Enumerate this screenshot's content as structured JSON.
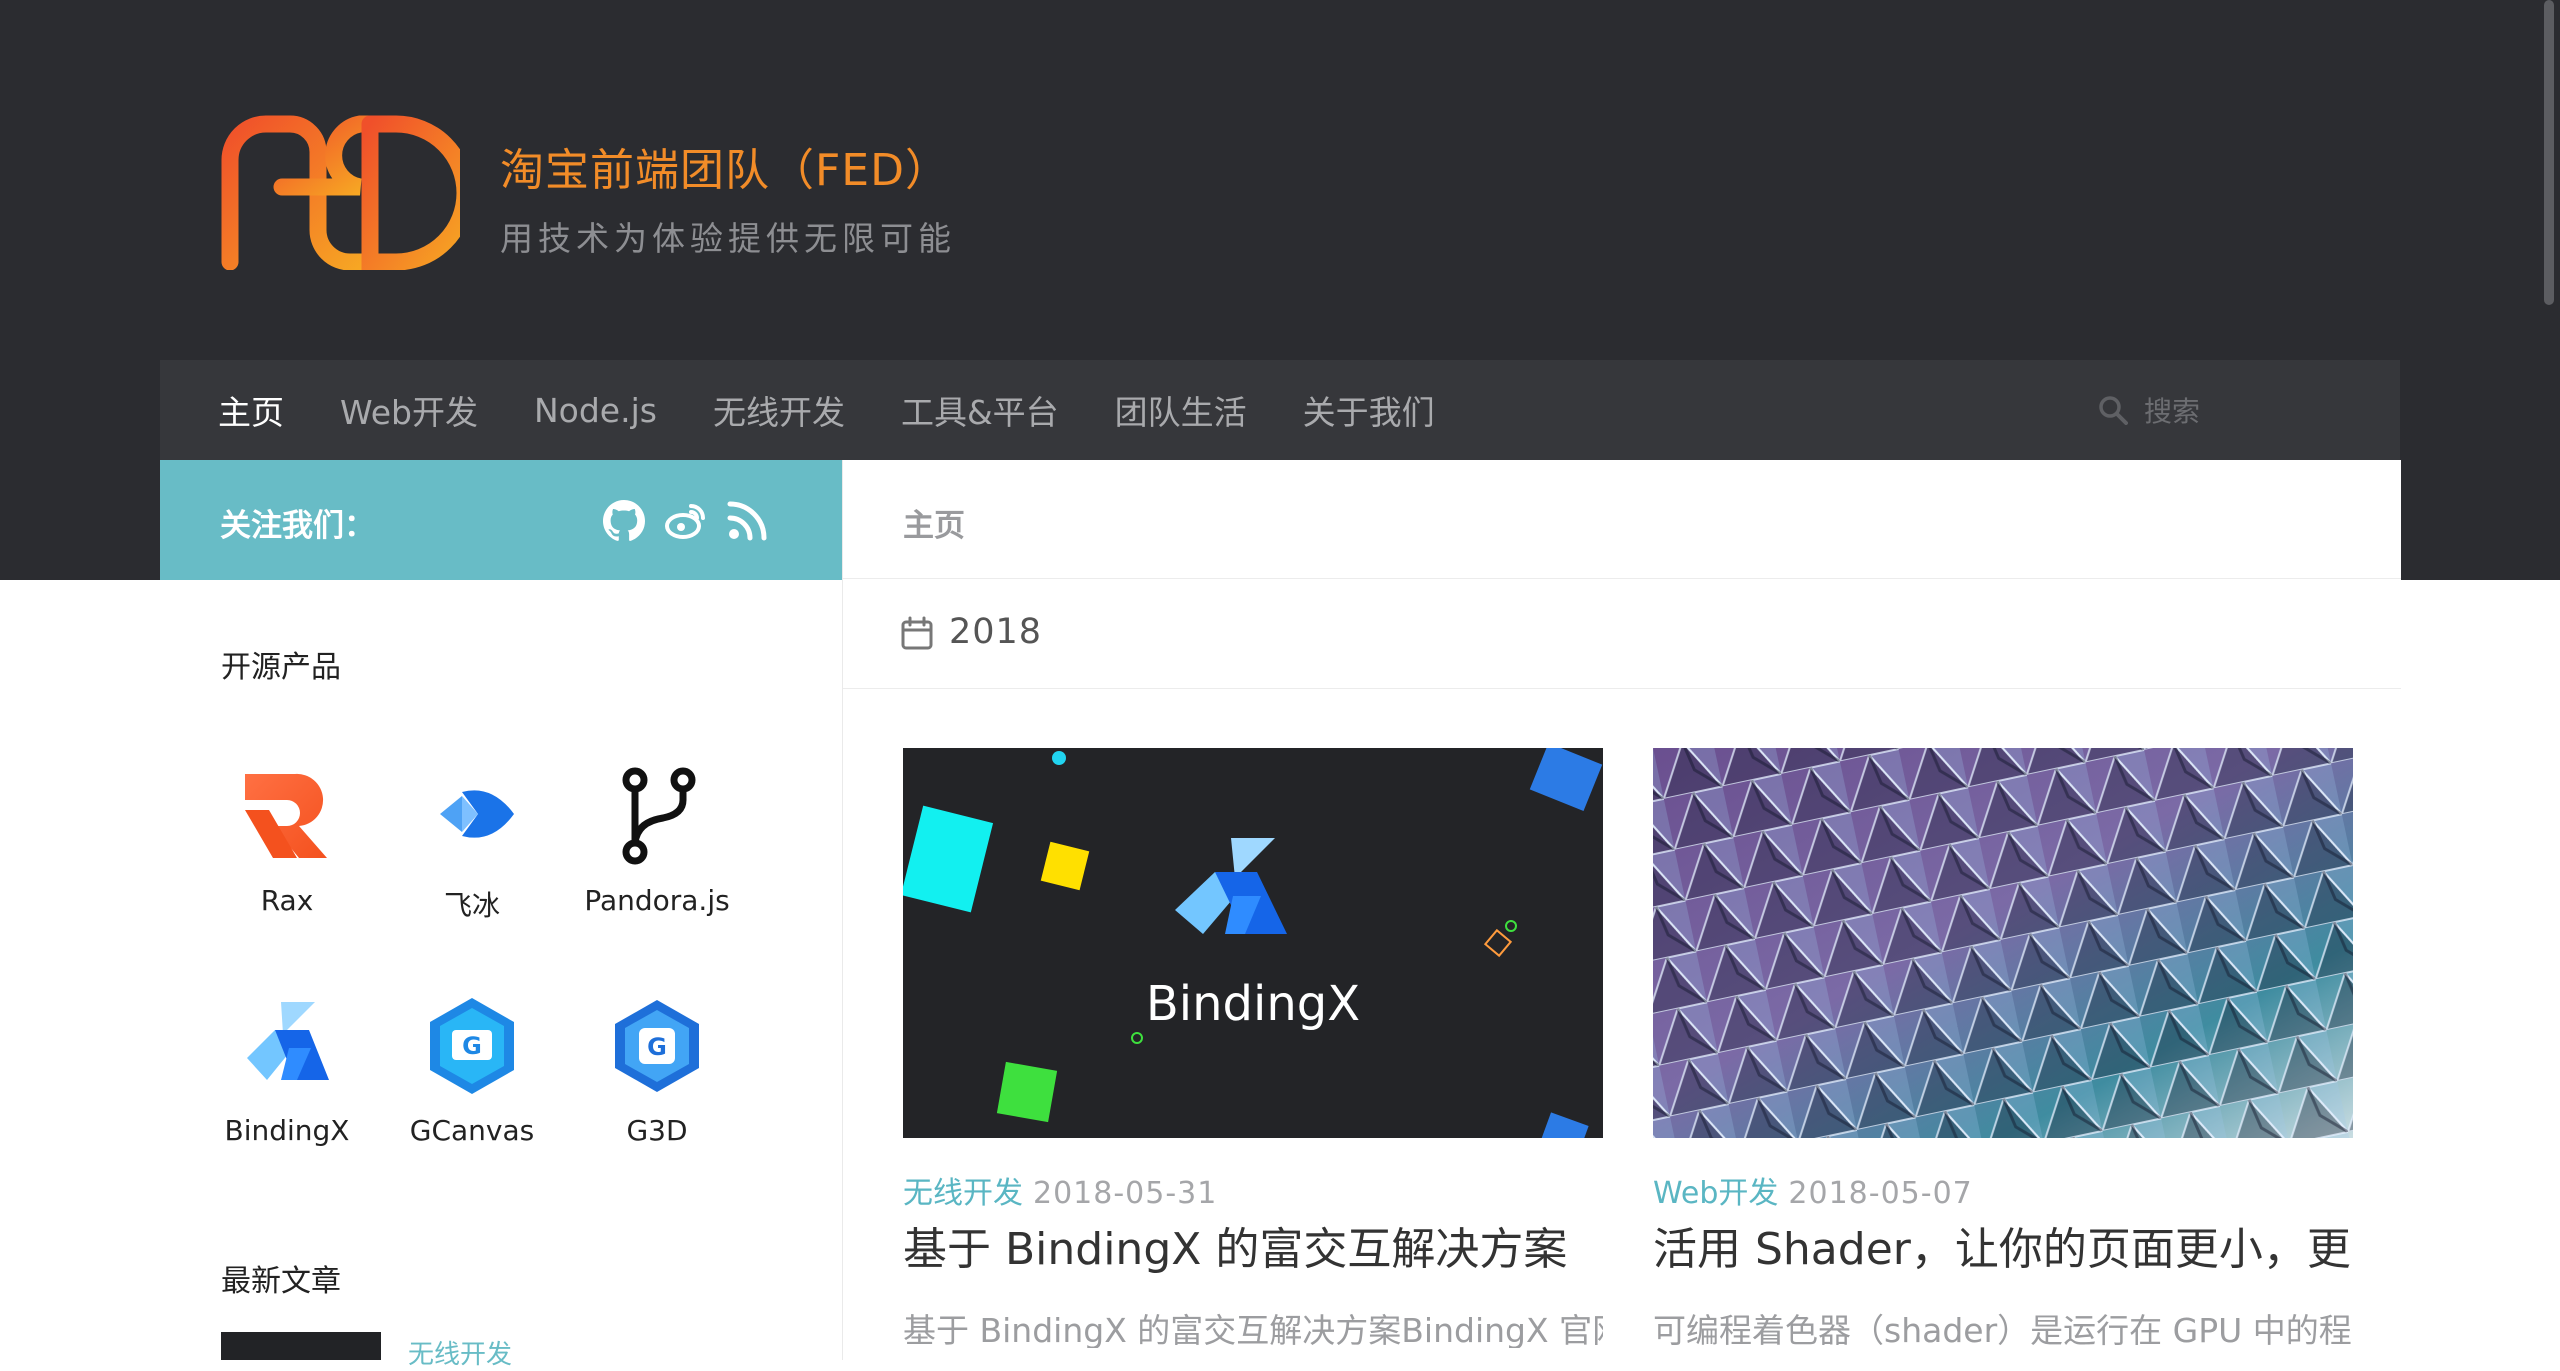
{
  "site": {
    "title": "淘宝前端团队（FED）",
    "tagline": "用技术为体验提供无限可能",
    "accent": "#f28c28",
    "teal": "#68bcc6"
  },
  "nav": {
    "items": [
      {
        "label": "主页",
        "active": true
      },
      {
        "label": "Web开发"
      },
      {
        "label": "Node.js"
      },
      {
        "label": "无线开发"
      },
      {
        "label": "工具&平台"
      },
      {
        "label": "团队生活"
      },
      {
        "label": "关于我们"
      }
    ],
    "search_placeholder": "搜索",
    "search_icon": "search-icon"
  },
  "follow": {
    "label": "关注我们：",
    "icons": [
      "github-icon",
      "weibo-icon",
      "rss-icon"
    ]
  },
  "sidebar": {
    "products_heading": "开源产品",
    "products": [
      {
        "label": "Rax",
        "icon": "rax-logo-icon"
      },
      {
        "label": "飞冰",
        "icon": "ice-logo-icon"
      },
      {
        "label": "Pandora.js",
        "icon": "pandora-logo-icon"
      },
      {
        "label": "BindingX",
        "icon": "bindingx-logo-icon"
      },
      {
        "label": "GCanvas",
        "icon": "gcanvas-logo-icon"
      },
      {
        "label": "G3D",
        "icon": "g3d-logo-icon"
      }
    ],
    "recent_heading": "最新文章",
    "recent_first_category": "无线开发"
  },
  "main": {
    "breadcrumb": "主页",
    "year": "2018",
    "year_icon": "calendar-icon",
    "posts": [
      {
        "category": "无线开发",
        "date": "2018-05-31",
        "title": "基于 BindingX 的富交互解决方案",
        "excerpt": "基于 BindingX 的富交互解决方案BindingX 官网:",
        "thumb_text": "BindingX"
      },
      {
        "category": "Web开发",
        "date": "2018-05-07",
        "title": "活用 Shader，让你的页面更小，更",
        "excerpt": "可编程着色器（shader）是运行在 GPU 中的程"
      }
    ]
  }
}
